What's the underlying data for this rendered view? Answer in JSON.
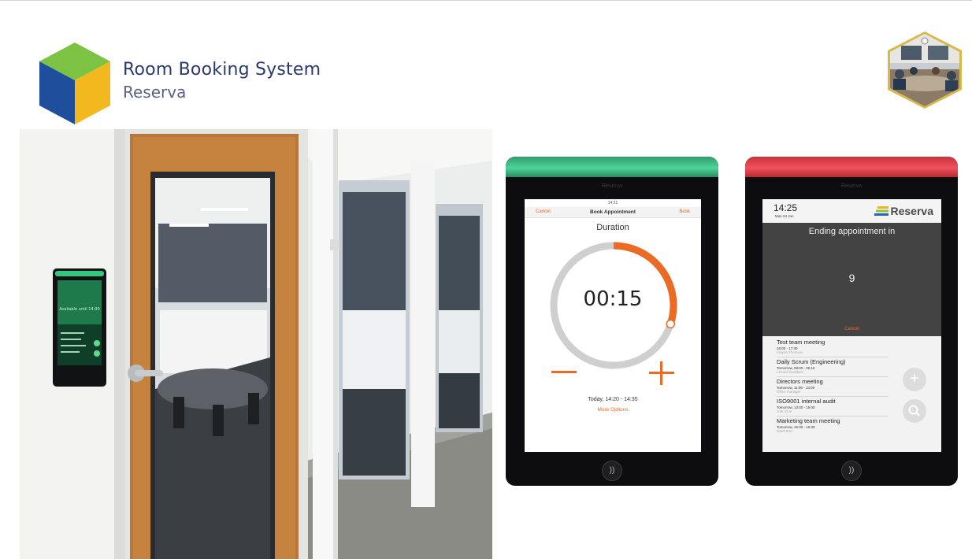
{
  "header": {
    "title": "Room Booking System",
    "subtitle": "Reserva"
  },
  "colors": {
    "accent": "#ec6b24",
    "available_led": "#4fd49a",
    "busy_led": "#f0525c",
    "brand_navy": "#2a3a6e"
  },
  "tablet_booking": {
    "brand": "Reserva",
    "clock": "14:21",
    "nav": {
      "cancel": "Cancel",
      "title": "Book Appointment",
      "book": "Book"
    },
    "duration_label": "Duration",
    "duration_value": "00:15",
    "duration_progress": 0.3,
    "time_range": "Today, 14:20 - 14:35",
    "more_options": "More Options",
    "nfc_icon": "nfc-icon"
  },
  "tablet_ending": {
    "brand": "Reserva",
    "time": "14:25",
    "date": "Mon 24 Jun",
    "logo_text": "Reserva",
    "message": "Ending appointment in",
    "countdown": "9",
    "cancel": "Cancel",
    "appointments": [
      {
        "title": "Test team meeting",
        "when": "16:00 - 17:30",
        "who": "Kalyna Thomson"
      },
      {
        "title": "Daily Scrum (Engineering)",
        "when": "Tomorrow, 09:00 - 09:15",
        "who": "Lenard Stoddard"
      },
      {
        "title": "Directors meeting",
        "when": "Tomorrow, 11:00 - 13:00",
        "who": "Office manager"
      },
      {
        "title": "ISO9001 internal audit",
        "when": "Tomorrow, 13:00 - 15:00",
        "who": "John Doe"
      },
      {
        "title": "Marketing team meeting",
        "when": "Tomorrow, 15:00 - 16:30",
        "who": "Odell Bird"
      }
    ],
    "add_icon": "plus-icon",
    "search_icon": "search-icon"
  }
}
